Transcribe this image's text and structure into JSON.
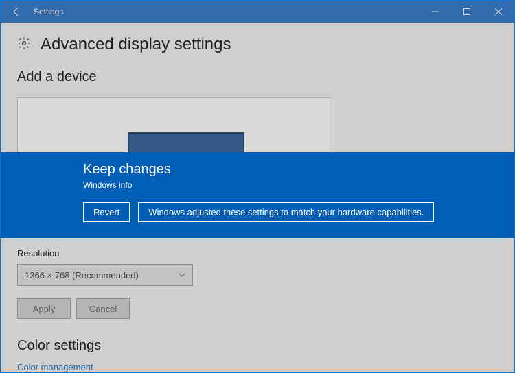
{
  "window": {
    "title": "Settings"
  },
  "page": {
    "title": "Advanced display settings"
  },
  "sections": {
    "add_device": "Add a device",
    "resolution_label": "Resolution",
    "resolution_value": "1366 × 768 (Recommended)",
    "apply": "Apply",
    "cancel": "Cancel",
    "color_settings": "Color settings",
    "color_management": "Color management"
  },
  "banner": {
    "title": "Keep changes",
    "subtitle": "Windows info",
    "revert": "Revert",
    "message": "Windows adjusted these settings to match your hardware capabilities."
  }
}
